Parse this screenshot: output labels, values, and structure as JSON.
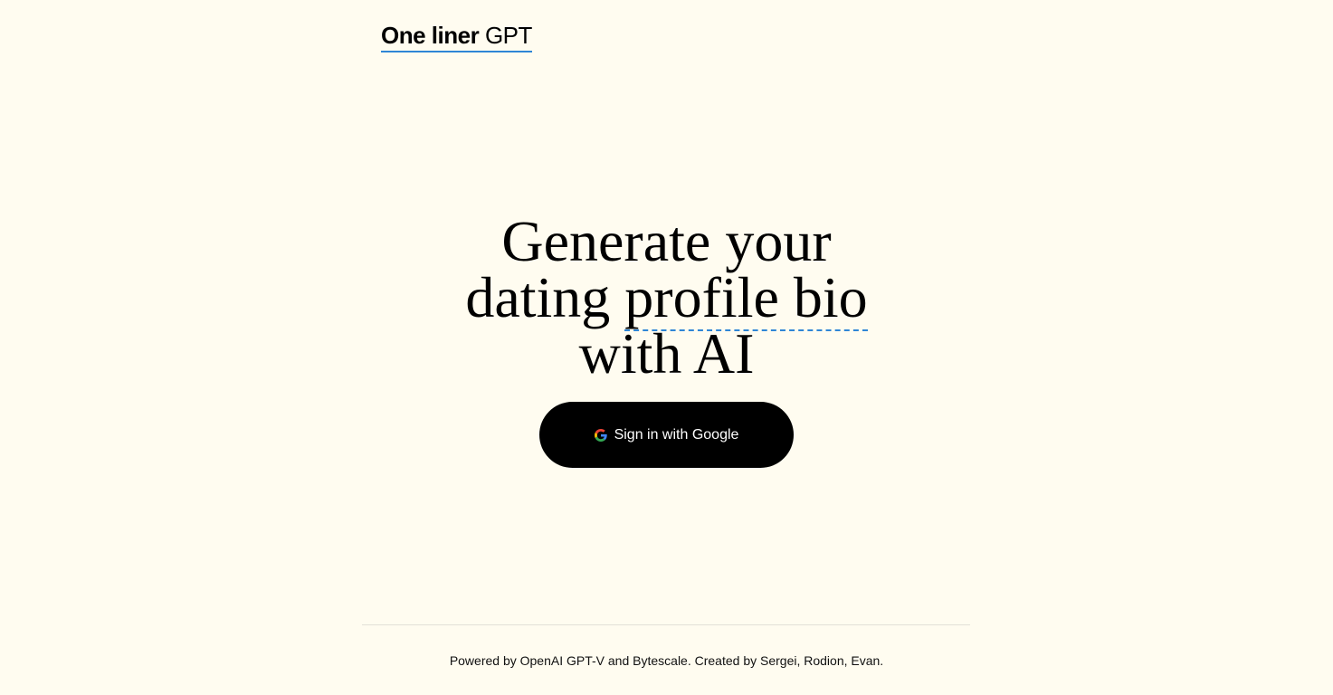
{
  "header": {
    "logo_bold": "One liner",
    "logo_light": "GPT"
  },
  "hero": {
    "line1": "Generate your",
    "line2_start": "dating ",
    "line2_accent": "profile bio",
    "line3": "with AI"
  },
  "signin": {
    "label": "Sign in with Google",
    "icon": "google-g-icon"
  },
  "footer": {
    "text": "Powered by OpenAI GPT-V and Bytescale. Created by Sergei, Rodion, Evan."
  },
  "colors": {
    "background": "#fffcf0",
    "accent": "#2f86d6",
    "button": "#000000",
    "google_blue": "#4285F4",
    "google_red": "#EA4335",
    "google_yellow": "#FBBC05",
    "google_green": "#34A853"
  }
}
